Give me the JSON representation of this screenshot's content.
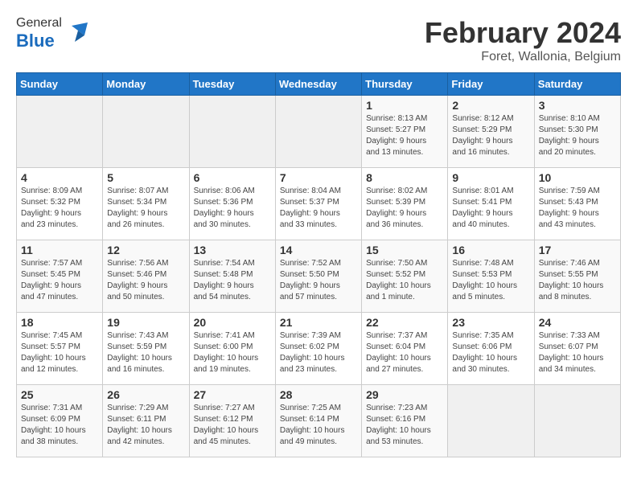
{
  "logo": {
    "general": "General",
    "blue": "Blue"
  },
  "title": "February 2024",
  "location": "Foret, Wallonia, Belgium",
  "days_of_week": [
    "Sunday",
    "Monday",
    "Tuesday",
    "Wednesday",
    "Thursday",
    "Friday",
    "Saturday"
  ],
  "weeks": [
    [
      {
        "day": "",
        "info": ""
      },
      {
        "day": "",
        "info": ""
      },
      {
        "day": "",
        "info": ""
      },
      {
        "day": "",
        "info": ""
      },
      {
        "day": "1",
        "info": "Sunrise: 8:13 AM\nSunset: 5:27 PM\nDaylight: 9 hours\nand 13 minutes."
      },
      {
        "day": "2",
        "info": "Sunrise: 8:12 AM\nSunset: 5:29 PM\nDaylight: 9 hours\nand 16 minutes."
      },
      {
        "day": "3",
        "info": "Sunrise: 8:10 AM\nSunset: 5:30 PM\nDaylight: 9 hours\nand 20 minutes."
      }
    ],
    [
      {
        "day": "4",
        "info": "Sunrise: 8:09 AM\nSunset: 5:32 PM\nDaylight: 9 hours\nand 23 minutes."
      },
      {
        "day": "5",
        "info": "Sunrise: 8:07 AM\nSunset: 5:34 PM\nDaylight: 9 hours\nand 26 minutes."
      },
      {
        "day": "6",
        "info": "Sunrise: 8:06 AM\nSunset: 5:36 PM\nDaylight: 9 hours\nand 30 minutes."
      },
      {
        "day": "7",
        "info": "Sunrise: 8:04 AM\nSunset: 5:37 PM\nDaylight: 9 hours\nand 33 minutes."
      },
      {
        "day": "8",
        "info": "Sunrise: 8:02 AM\nSunset: 5:39 PM\nDaylight: 9 hours\nand 36 minutes."
      },
      {
        "day": "9",
        "info": "Sunrise: 8:01 AM\nSunset: 5:41 PM\nDaylight: 9 hours\nand 40 minutes."
      },
      {
        "day": "10",
        "info": "Sunrise: 7:59 AM\nSunset: 5:43 PM\nDaylight: 9 hours\nand 43 minutes."
      }
    ],
    [
      {
        "day": "11",
        "info": "Sunrise: 7:57 AM\nSunset: 5:45 PM\nDaylight: 9 hours\nand 47 minutes."
      },
      {
        "day": "12",
        "info": "Sunrise: 7:56 AM\nSunset: 5:46 PM\nDaylight: 9 hours\nand 50 minutes."
      },
      {
        "day": "13",
        "info": "Sunrise: 7:54 AM\nSunset: 5:48 PM\nDaylight: 9 hours\nand 54 minutes."
      },
      {
        "day": "14",
        "info": "Sunrise: 7:52 AM\nSunset: 5:50 PM\nDaylight: 9 hours\nand 57 minutes."
      },
      {
        "day": "15",
        "info": "Sunrise: 7:50 AM\nSunset: 5:52 PM\nDaylight: 10 hours\nand 1 minute."
      },
      {
        "day": "16",
        "info": "Sunrise: 7:48 AM\nSunset: 5:53 PM\nDaylight: 10 hours\nand 5 minutes."
      },
      {
        "day": "17",
        "info": "Sunrise: 7:46 AM\nSunset: 5:55 PM\nDaylight: 10 hours\nand 8 minutes."
      }
    ],
    [
      {
        "day": "18",
        "info": "Sunrise: 7:45 AM\nSunset: 5:57 PM\nDaylight: 10 hours\nand 12 minutes."
      },
      {
        "day": "19",
        "info": "Sunrise: 7:43 AM\nSunset: 5:59 PM\nDaylight: 10 hours\nand 16 minutes."
      },
      {
        "day": "20",
        "info": "Sunrise: 7:41 AM\nSunset: 6:00 PM\nDaylight: 10 hours\nand 19 minutes."
      },
      {
        "day": "21",
        "info": "Sunrise: 7:39 AM\nSunset: 6:02 PM\nDaylight: 10 hours\nand 23 minutes."
      },
      {
        "day": "22",
        "info": "Sunrise: 7:37 AM\nSunset: 6:04 PM\nDaylight: 10 hours\nand 27 minutes."
      },
      {
        "day": "23",
        "info": "Sunrise: 7:35 AM\nSunset: 6:06 PM\nDaylight: 10 hours\nand 30 minutes."
      },
      {
        "day": "24",
        "info": "Sunrise: 7:33 AM\nSunset: 6:07 PM\nDaylight: 10 hours\nand 34 minutes."
      }
    ],
    [
      {
        "day": "25",
        "info": "Sunrise: 7:31 AM\nSunset: 6:09 PM\nDaylight: 10 hours\nand 38 minutes."
      },
      {
        "day": "26",
        "info": "Sunrise: 7:29 AM\nSunset: 6:11 PM\nDaylight: 10 hours\nand 42 minutes."
      },
      {
        "day": "27",
        "info": "Sunrise: 7:27 AM\nSunset: 6:12 PM\nDaylight: 10 hours\nand 45 minutes."
      },
      {
        "day": "28",
        "info": "Sunrise: 7:25 AM\nSunset: 6:14 PM\nDaylight: 10 hours\nand 49 minutes."
      },
      {
        "day": "29",
        "info": "Sunrise: 7:23 AM\nSunset: 6:16 PM\nDaylight: 10 hours\nand 53 minutes."
      },
      {
        "day": "",
        "info": ""
      },
      {
        "day": "",
        "info": ""
      }
    ]
  ]
}
